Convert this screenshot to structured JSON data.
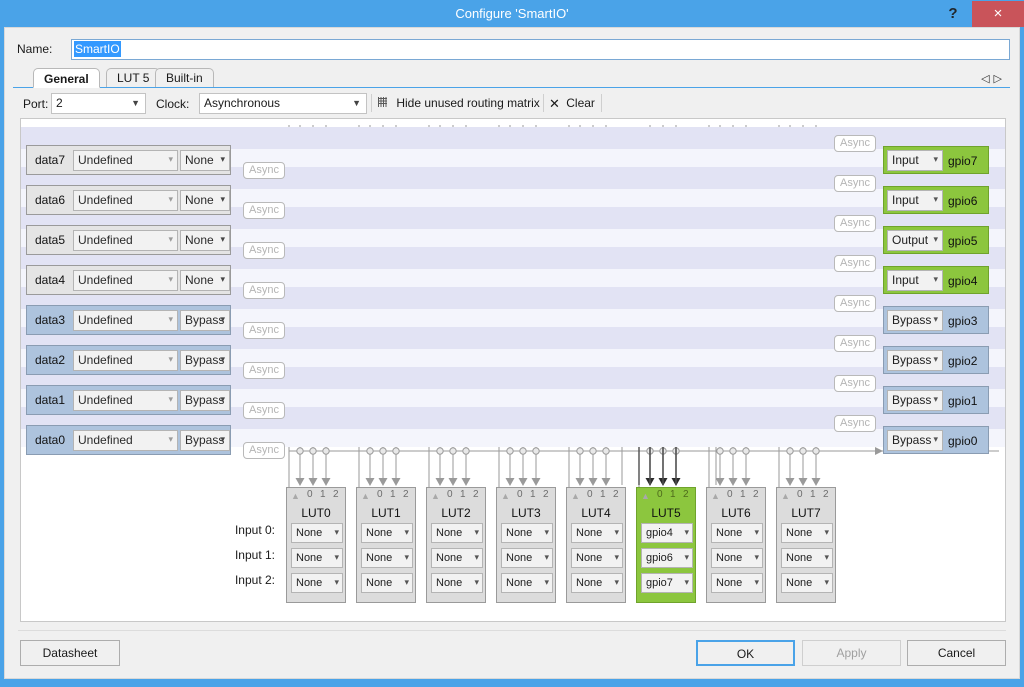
{
  "window": {
    "title": "Configure 'SmartIO'",
    "help_label": "?",
    "close_label": "×"
  },
  "name_field": {
    "label": "Name:",
    "value": "SmartIO"
  },
  "tabs": [
    {
      "label": "General",
      "active": true
    },
    {
      "label": "LUT 5",
      "active": false
    },
    {
      "label": "Built-in",
      "active": false
    }
  ],
  "tab_nav": {
    "prev": "◁",
    "next": "▷"
  },
  "toolbar": {
    "port_label": "Port:",
    "port_value": "2",
    "clock_label": "Clock:",
    "clock_value": "Asynchronous",
    "hide_label": "Hide unused routing matrix",
    "clear_label": "Clear",
    "clear_glyph": "✕"
  },
  "async_label": "Async",
  "data_rows": [
    {
      "name": "data7",
      "source": "Undefined",
      "sync": "None",
      "selected": false
    },
    {
      "name": "data6",
      "source": "Undefined",
      "sync": "None",
      "selected": false
    },
    {
      "name": "data5",
      "source": "Undefined",
      "sync": "None",
      "selected": false
    },
    {
      "name": "data4",
      "source": "Undefined",
      "sync": "None",
      "selected": false
    },
    {
      "name": "data3",
      "source": "Undefined",
      "sync": "Bypass",
      "selected": true
    },
    {
      "name": "data2",
      "source": "Undefined",
      "sync": "Bypass",
      "selected": true
    },
    {
      "name": "data1",
      "source": "Undefined",
      "sync": "Bypass",
      "selected": true
    },
    {
      "name": "data0",
      "source": "Undefined",
      "sync": "Bypass",
      "selected": true
    }
  ],
  "gpio_rows": [
    {
      "name": "gpio7",
      "mode": "Input",
      "highlight": "green"
    },
    {
      "name": "gpio6",
      "mode": "Input",
      "highlight": "green"
    },
    {
      "name": "gpio5",
      "mode": "Output",
      "highlight": "green"
    },
    {
      "name": "gpio4",
      "mode": "Input",
      "highlight": "green"
    },
    {
      "name": "gpio3",
      "mode": "Bypass",
      "highlight": "blue"
    },
    {
      "name": "gpio2",
      "mode": "Bypass",
      "highlight": "blue"
    },
    {
      "name": "gpio1",
      "mode": "Bypass",
      "highlight": "blue"
    },
    {
      "name": "gpio0",
      "mode": "Bypass",
      "highlight": "blue"
    }
  ],
  "lut_input_labels": [
    "Input 0:",
    "Input 1:",
    "Input 2:"
  ],
  "lut_column_headers": [
    "0",
    "1",
    "2"
  ],
  "luts": [
    {
      "title": "LUT0",
      "highlight": false,
      "inputs": [
        "None",
        "None",
        "None"
      ]
    },
    {
      "title": "LUT1",
      "highlight": false,
      "inputs": [
        "None",
        "None",
        "None"
      ]
    },
    {
      "title": "LUT2",
      "highlight": false,
      "inputs": [
        "None",
        "None",
        "None"
      ]
    },
    {
      "title": "LUT3",
      "highlight": false,
      "inputs": [
        "None",
        "None",
        "None"
      ]
    },
    {
      "title": "LUT4",
      "highlight": false,
      "inputs": [
        "None",
        "None",
        "None"
      ]
    },
    {
      "title": "LUT5",
      "highlight": true,
      "inputs": [
        "gpio4",
        "gpio6",
        "gpio7"
      ]
    },
    {
      "title": "LUT6",
      "highlight": false,
      "inputs": [
        "None",
        "None",
        "None"
      ]
    },
    {
      "title": "LUT7",
      "highlight": false,
      "inputs": [
        "None",
        "None",
        "None"
      ]
    }
  ],
  "buttons": {
    "datasheet": "Datasheet",
    "ok": "OK",
    "apply": "Apply",
    "cancel": "Cancel"
  },
  "colors": {
    "title_bar": "#4aa3e8",
    "close": "#c9545a",
    "highlight_green": "#8cc63e",
    "highlight_blue": "#adc3dd",
    "band_a": "#e2e3f4",
    "band_b": "#f4f5fc"
  }
}
